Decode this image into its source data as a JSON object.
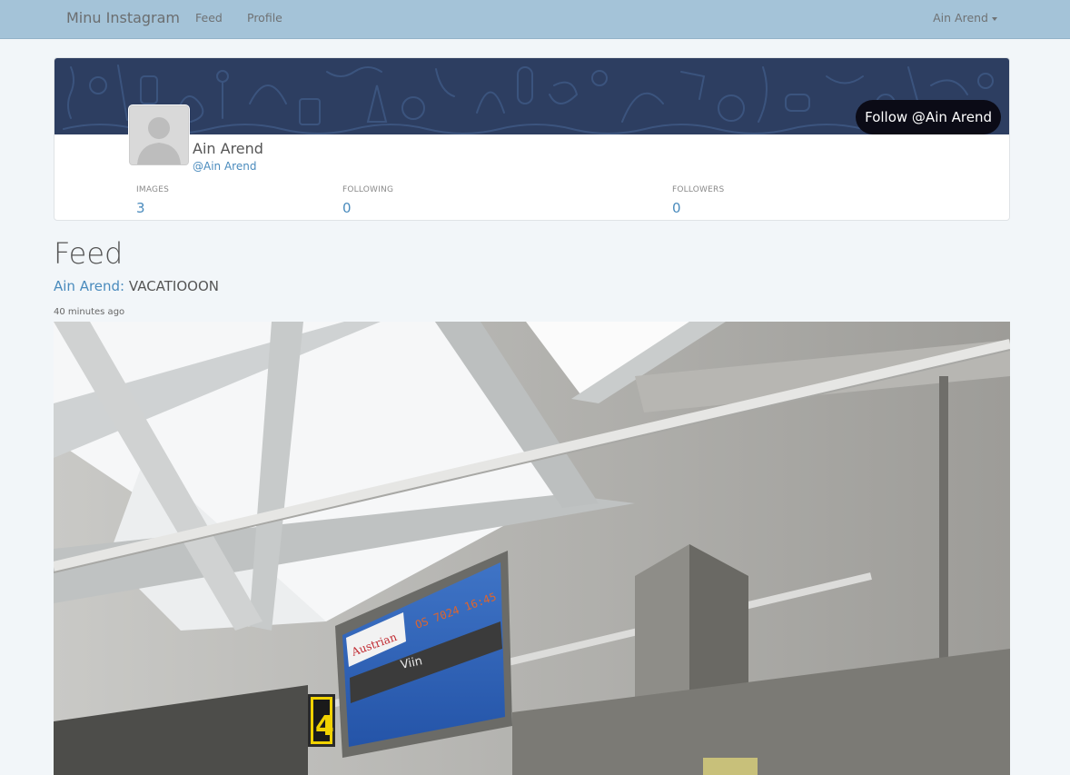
{
  "navbar": {
    "brand": "Minu Instagram",
    "links": [
      "Feed",
      "Profile"
    ],
    "user": "Ain Arend"
  },
  "profile": {
    "name": "Ain Arend",
    "handle": "@Ain Arend",
    "follow_label": "Follow @Ain Arend",
    "stats": [
      {
        "label": "IMAGES",
        "value": "3"
      },
      {
        "label": "FOLLOWING",
        "value": "0"
      },
      {
        "label": "FOLLOWERS",
        "value": "0"
      }
    ]
  },
  "feed": {
    "title": "Feed",
    "posts": [
      {
        "author": "Ain Arend:",
        "caption": " VACATIOOON",
        "time": "40 minutes ago",
        "image": {
          "display_brand": "Austrian",
          "display_flight": "OS 7024 16:45",
          "display_destination": "Viin",
          "gate_number": "4"
        }
      }
    ]
  },
  "colors": {
    "navbar_bg": "#a4c3d8",
    "link": "#4a8bbd",
    "cover": "#2d3e61",
    "follow_button": "#0b0b16"
  }
}
